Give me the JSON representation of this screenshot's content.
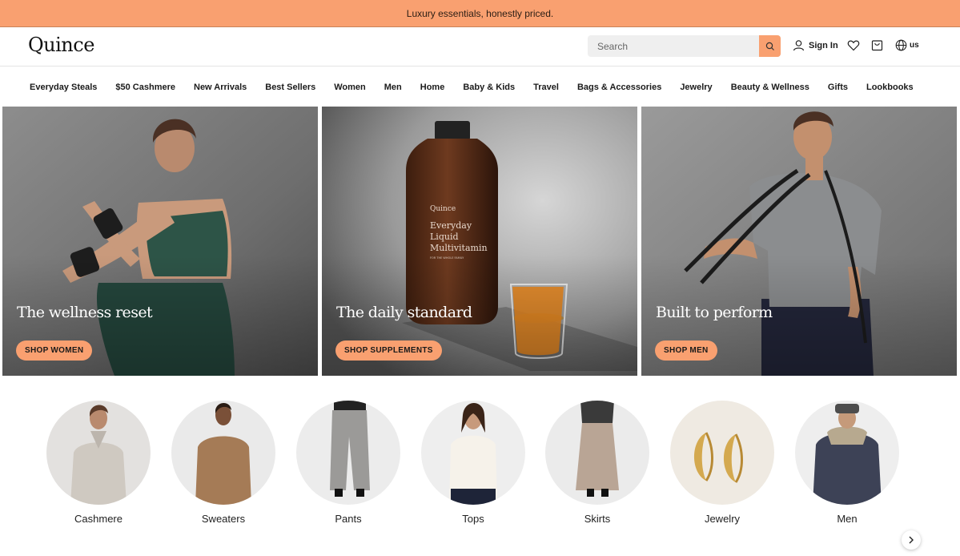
{
  "promo": {
    "text": "Luxury essentials, honestly priced."
  },
  "header": {
    "logo": "Quince",
    "search_placeholder": "Search",
    "signin_label": "Sign In",
    "locale_label": "us"
  },
  "nav": [
    "Everyday Steals",
    "$50 Cashmere",
    "New Arrivals",
    "Best Sellers",
    "Women",
    "Men",
    "Home",
    "Baby & Kids",
    "Travel",
    "Bags & Accessories",
    "Jewelry",
    "Beauty & Wellness",
    "Gifts",
    "Lookbooks"
  ],
  "heroes": [
    {
      "headline": "The wellness reset",
      "cta": "SHOP WOMEN"
    },
    {
      "headline": "The daily standard",
      "cta": "SHOP SUPPLEMENTS",
      "bottle_brand": "Quince",
      "bottle_product": [
        "Everyday",
        "Liquid",
        "Multivitamin"
      ],
      "bottle_sub": "FOR THE WHOLE FAMILY"
    },
    {
      "headline": "Built to perform",
      "cta": "SHOP MEN"
    }
  ],
  "categories": [
    "Cashmere",
    "Sweaters",
    "Pants",
    "Tops",
    "Skirts",
    "Jewelry",
    "Men"
  ],
  "colors": {
    "accent": "#f9a070"
  }
}
